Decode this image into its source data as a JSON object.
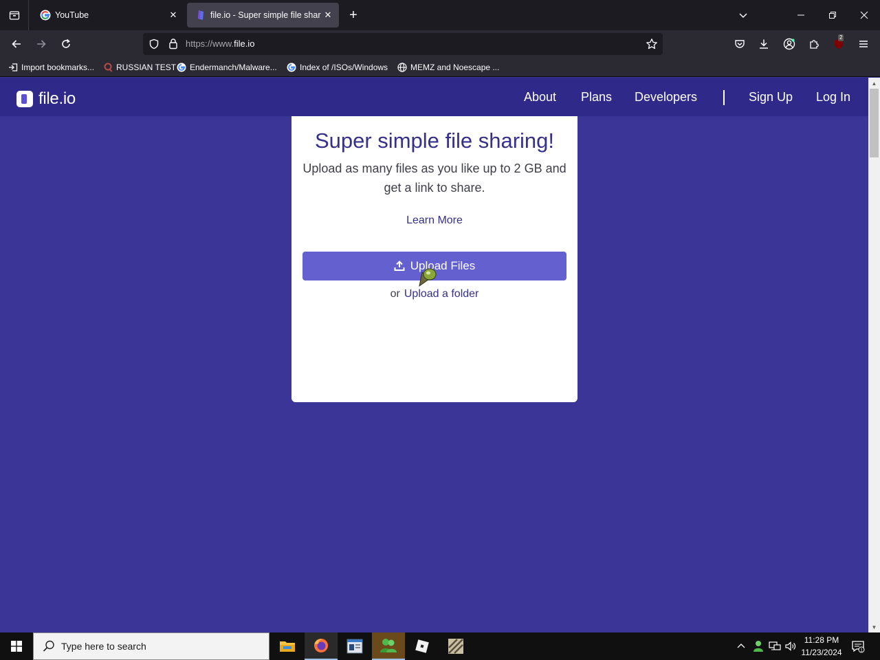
{
  "browser": {
    "tabs": [
      {
        "title": "YouTube",
        "active": false
      },
      {
        "title": "file.io - Super simple file sharing",
        "active": true
      }
    ],
    "url": {
      "scheme": "https://www.",
      "host": "file.io"
    },
    "bookmarks": [
      {
        "label": "Import bookmarks...",
        "icon": "import-icon"
      },
      {
        "label": "RUSSIAN TEST",
        "icon": "search-bookmark-icon"
      },
      {
        "label": "Endermanch/Malware...",
        "icon": "google-icon"
      },
      {
        "label": "Index of /ISOs/Windows",
        "icon": "google-icon"
      },
      {
        "label": "MEMZ and Noescape ...",
        "icon": "globe-icon"
      }
    ],
    "extension_badge": "2"
  },
  "site": {
    "logo": "file.io",
    "nav": {
      "about": "About",
      "plans": "Plans",
      "developers": "Developers",
      "signup": "Sign Up",
      "login": "Log In"
    },
    "card": {
      "title": "Super simple file sharing!",
      "subtitle": "Upload as many files as you like up to 2 GB and get a link to share.",
      "learn_more": "Learn More",
      "upload_button": "Upload Files",
      "or": "or",
      "upload_folder": "Upload a folder"
    }
  },
  "taskbar": {
    "search_placeholder": "Type here to search",
    "time": "11:28 PM",
    "date": "11/23/2024"
  },
  "colors": {
    "page_bg": "#3a3597",
    "header_bg": "#2f2a8a",
    "accent": "#6460d0",
    "title": "#35308a"
  }
}
